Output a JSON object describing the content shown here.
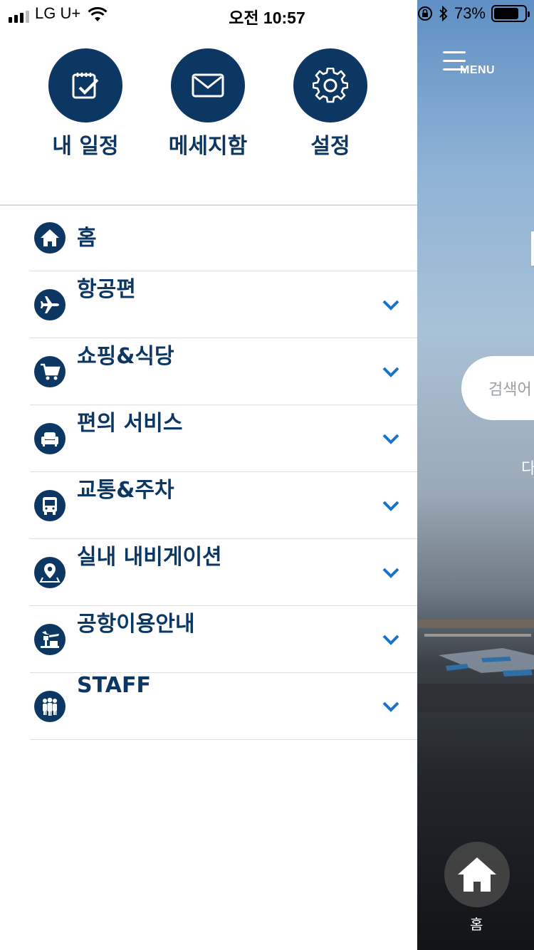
{
  "status_bar": {
    "carrier": "LG U+",
    "time": "오전 10:57",
    "battery": "73%",
    "battery_level": 0.73
  },
  "quick_actions": [
    {
      "label": "내 일정",
      "icon": "calendar-check-icon"
    },
    {
      "label": "메세지함",
      "icon": "envelope-icon"
    },
    {
      "label": "설정",
      "icon": "gear-icon"
    }
  ],
  "menu": {
    "items": [
      {
        "label": "홈",
        "icon": "home-icon",
        "expandable": false
      },
      {
        "label": "항공편",
        "icon": "airplane-icon",
        "expandable": true
      },
      {
        "label": "쇼핑&식당",
        "icon": "shopping-cart-icon",
        "expandable": true
      },
      {
        "label": "편의 서비스",
        "icon": "sofa-icon",
        "expandable": true
      },
      {
        "label": "교통&주차",
        "icon": "bus-icon",
        "expandable": true
      },
      {
        "label": "실내 내비게이션",
        "icon": "map-pin-icon",
        "expandable": true
      },
      {
        "label": "공항이용안내",
        "icon": "airport-tower-icon",
        "expandable": true
      },
      {
        "label": "STAFF",
        "icon": "people-icon",
        "expandable": true
      }
    ]
  },
  "background_app": {
    "menu_label": "MENU",
    "search_placeholder": "검색어",
    "sub_text_fragment": "다",
    "home_label": "홈"
  },
  "colors": {
    "primary": "#0d3763",
    "chevron": "#1a73c7",
    "divider": "#dedede"
  }
}
